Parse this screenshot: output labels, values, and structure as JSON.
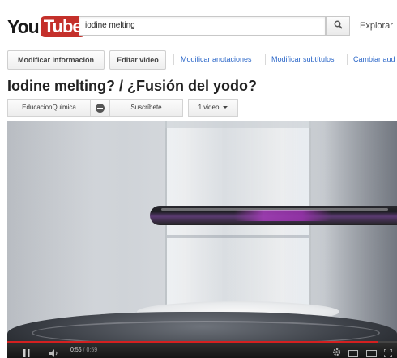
{
  "header": {
    "logo_you": "You",
    "logo_tube": "Tube",
    "search_value": "iodine melting",
    "explore_label": "Explorar"
  },
  "toolbar": {
    "edit_info_label": "Modificar información",
    "edit_video_label": "Editar video",
    "annotations_label": "Modificar anotaciones",
    "subtitles_label": "Modificar subtítulos",
    "audio_label": "Cambiar aud"
  },
  "video": {
    "title": "Iodine melting? / ¿Fusión del yodo?",
    "channel_name": "EducacionQuimica",
    "subscribe_label": "Suscríbete",
    "video_count_label": "1 video"
  },
  "player": {
    "current_time": "0:56",
    "time_separator": "/",
    "duration": "0:59",
    "progress_fraction": 0.95,
    "accent_color": "#d42020"
  },
  "colors": {
    "brand_red": "#c4302b",
    "link_blue": "#2a66c8"
  }
}
